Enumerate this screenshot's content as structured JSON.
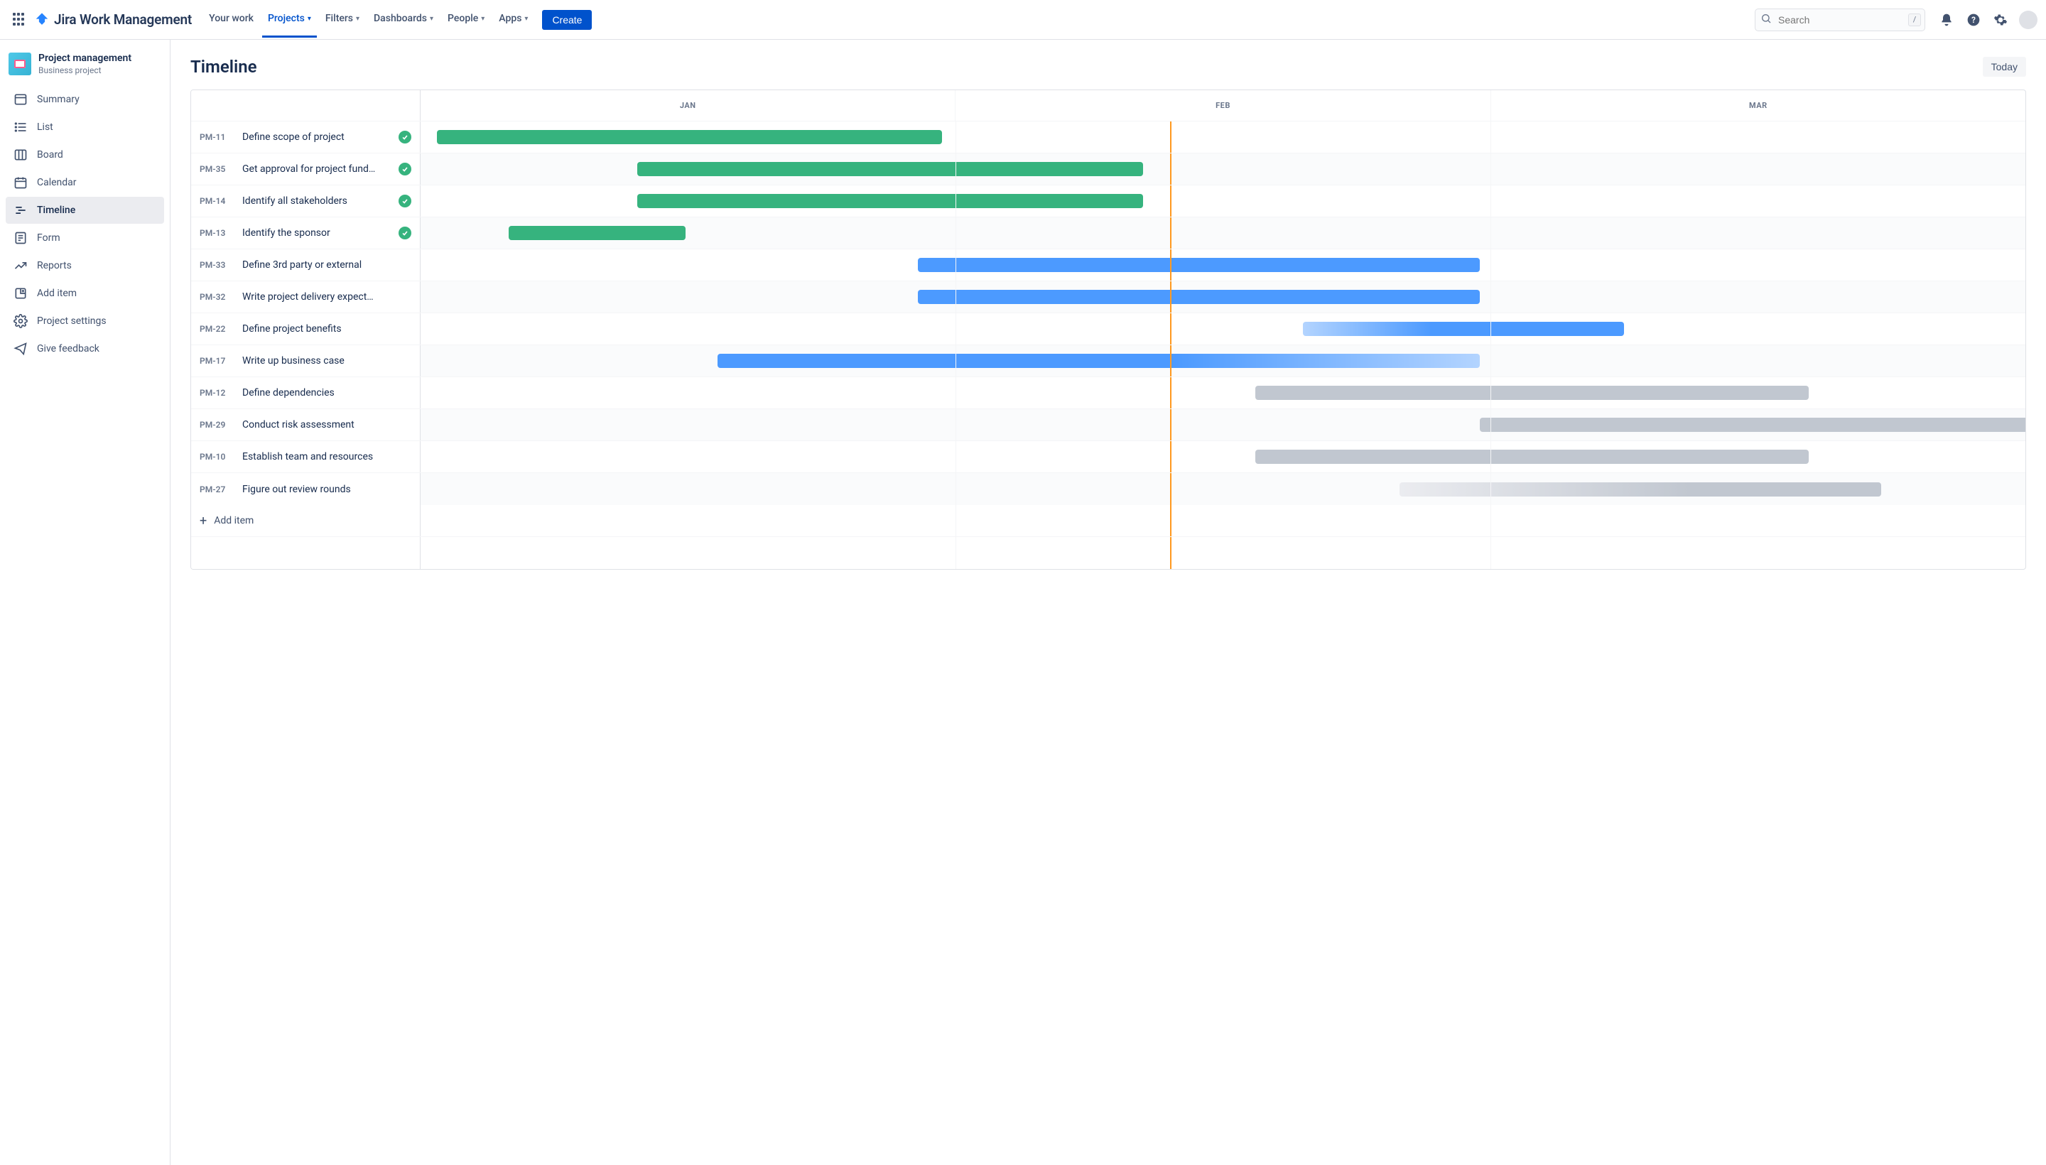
{
  "topnav": {
    "product_name": "Jira Work Management",
    "items": [
      {
        "label": "Your work",
        "has_dropdown": false,
        "active": false
      },
      {
        "label": "Projects",
        "has_dropdown": true,
        "active": true
      },
      {
        "label": "Filters",
        "has_dropdown": true,
        "active": false
      },
      {
        "label": "Dashboards",
        "has_dropdown": true,
        "active": false
      },
      {
        "label": "People",
        "has_dropdown": true,
        "active": false
      },
      {
        "label": "Apps",
        "has_dropdown": true,
        "active": false
      }
    ],
    "create_label": "Create",
    "search_placeholder": "Search",
    "slash_hint": "/"
  },
  "project": {
    "name": "Project management",
    "subtitle": "Business project"
  },
  "sidebar": {
    "items": [
      {
        "icon": "summary-icon",
        "label": "Summary",
        "active": false
      },
      {
        "icon": "list-icon",
        "label": "List",
        "active": false
      },
      {
        "icon": "board-icon",
        "label": "Board",
        "active": false
      },
      {
        "icon": "calendar-icon",
        "label": "Calendar",
        "active": false
      },
      {
        "icon": "timeline-icon",
        "label": "Timeline",
        "active": true
      },
      {
        "icon": "form-icon",
        "label": "Form",
        "active": false
      },
      {
        "icon": "reports-icon",
        "label": "Reports",
        "active": false
      },
      {
        "icon": "add-item-icon",
        "label": "Add item",
        "active": false
      },
      {
        "icon": "settings-icon",
        "label": "Project settings",
        "active": false
      },
      {
        "icon": "feedback-icon",
        "label": "Give feedback",
        "active": false
      }
    ]
  },
  "page": {
    "title": "Timeline",
    "today_button": "Today",
    "add_item_label": "Add item"
  },
  "timeline": {
    "months": [
      "JAN",
      "FEB",
      "MAR"
    ],
    "today_position_pct": 46.7,
    "tasks": [
      {
        "id": "PM-11",
        "name": "Define scope of project",
        "done": true,
        "start_pct": 1,
        "width_pct": 31.5,
        "color": "green"
      },
      {
        "id": "PM-35",
        "name": "Get approval for project fund…",
        "done": true,
        "start_pct": 13.5,
        "width_pct": 31.5,
        "color": "green"
      },
      {
        "id": "PM-14",
        "name": "Identify all stakeholders",
        "done": true,
        "start_pct": 13.5,
        "width_pct": 31.5,
        "color": "green"
      },
      {
        "id": "PM-13",
        "name": "Identify the sponsor",
        "done": true,
        "start_pct": 5.5,
        "width_pct": 11,
        "color": "green"
      },
      {
        "id": "PM-33",
        "name": "Define 3rd party or external",
        "done": false,
        "start_pct": 31,
        "width_pct": 35,
        "color": "blue"
      },
      {
        "id": "PM-32",
        "name": "Write project delivery expect…",
        "done": false,
        "start_pct": 31,
        "width_pct": 35,
        "color": "blue"
      },
      {
        "id": "PM-22",
        "name": "Define project benefits",
        "done": false,
        "start_pct": 55,
        "width_pct": 20,
        "color": "blue-grad"
      },
      {
        "id": "PM-17",
        "name": "Write up business case",
        "done": false,
        "start_pct": 18.5,
        "width_pct": 47.5,
        "color": "blue-grad-rev"
      },
      {
        "id": "PM-12",
        "name": "Define dependencies",
        "done": false,
        "start_pct": 52,
        "width_pct": 34.5,
        "color": "grey"
      },
      {
        "id": "PM-29",
        "name": "Conduct risk assessment",
        "done": false,
        "start_pct": 66,
        "width_pct": 34.5,
        "color": "grey"
      },
      {
        "id": "PM-10",
        "name": "Establish team and resources",
        "done": false,
        "start_pct": 52,
        "width_pct": 34.5,
        "color": "grey"
      },
      {
        "id": "PM-27",
        "name": "Figure out review rounds",
        "done": false,
        "start_pct": 61,
        "width_pct": 30,
        "color": "grey-grad"
      }
    ]
  }
}
